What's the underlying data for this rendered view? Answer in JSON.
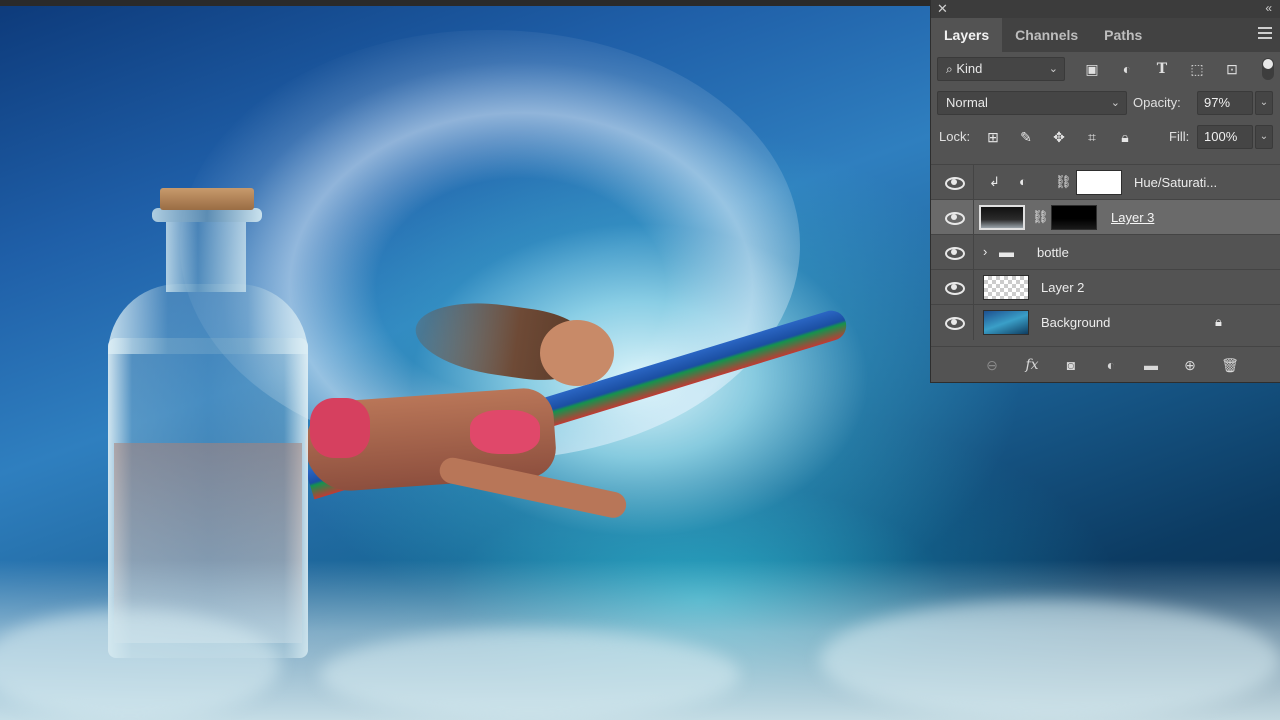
{
  "panel": {
    "tabs": [
      {
        "label": "Layers",
        "active": true
      },
      {
        "label": "Channels",
        "active": false
      },
      {
        "label": "Paths",
        "active": false
      }
    ],
    "filter": {
      "kind_label": "Kind",
      "icons": [
        "image-filter-icon",
        "adjustment-filter-icon",
        "type-filter-icon",
        "shape-filter-icon",
        "smart-object-filter-icon"
      ]
    },
    "blend_mode": "Normal",
    "opacity_label": "Opacity:",
    "opacity_value": "97%",
    "lock_label": "Lock:",
    "lock_icons": [
      "lock-transparent-icon",
      "lock-image-icon",
      "lock-position-icon",
      "lock-artboard-icon",
      "lock-all-icon"
    ],
    "fill_label": "Fill:",
    "fill_value": "100%",
    "layers": [
      {
        "name": "Hue/Saturati...",
        "type": "adjustment",
        "visible": true,
        "clipped": true,
        "selected": false
      },
      {
        "name": "Layer 3",
        "type": "masked",
        "visible": true,
        "selected": true
      },
      {
        "name": "bottle",
        "type": "group",
        "visible": true,
        "selected": false
      },
      {
        "name": "Layer 2",
        "type": "pixel",
        "visible": true,
        "selected": false
      },
      {
        "name": "Background",
        "type": "background",
        "visible": true,
        "locked": true,
        "selected": false
      }
    ],
    "footer_icons": [
      "link-layers-icon",
      "fx-icon",
      "add-mask-icon",
      "new-adjustment-icon",
      "new-group-icon",
      "new-layer-icon",
      "delete-layer-icon"
    ],
    "colors": {
      "panel_bg": "#535353",
      "tab_bar": "#424242",
      "selected_layer": "#6a6a6a"
    }
  }
}
